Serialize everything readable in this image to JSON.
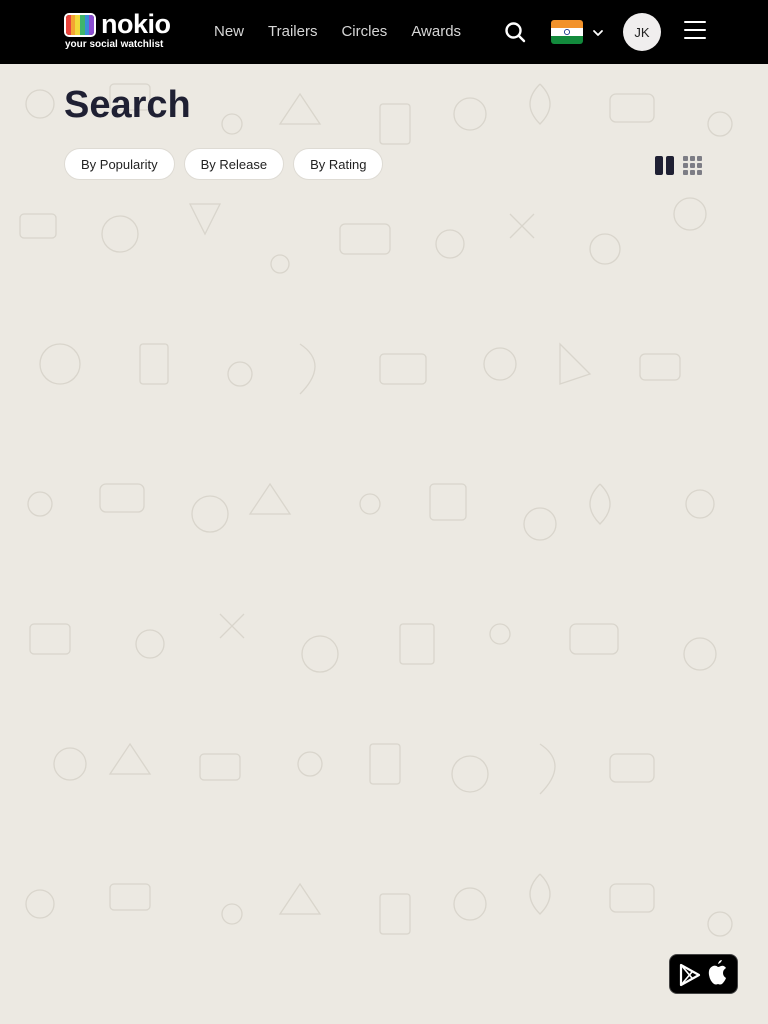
{
  "header": {
    "logo_word": "nokio",
    "logo_tagline": "your social watchlist",
    "nav": [
      "New",
      "Trailers",
      "Circles",
      "Awards"
    ],
    "avatar_initials": "JK",
    "country_flag": "india-flag-icon"
  },
  "main": {
    "title": "Search",
    "sort_buttons": [
      "By Popularity",
      "By Release",
      "By Rating"
    ],
    "view_modes": [
      "two-column-view-icon",
      "three-column-view-icon"
    ]
  },
  "app_badge": {
    "icons": [
      "google-play-icon",
      "apple-icon"
    ]
  },
  "colors": {
    "header_bg": "#000000",
    "page_bg": "#ece9e2",
    "title_color": "#1f2033"
  }
}
